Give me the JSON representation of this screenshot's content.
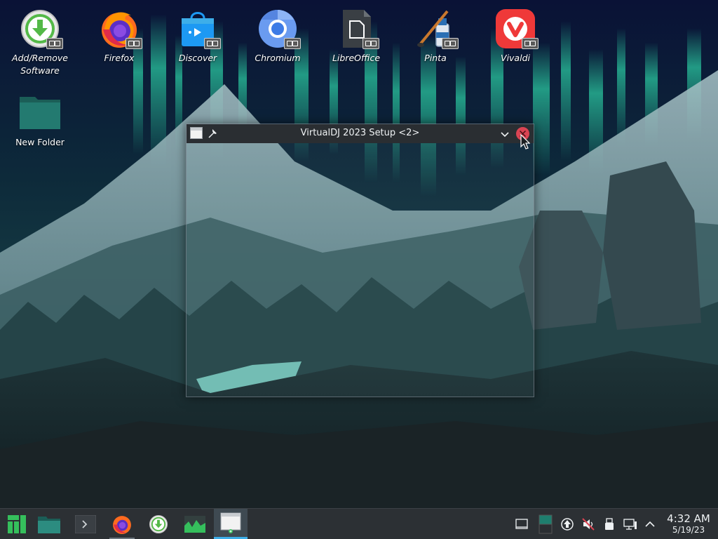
{
  "desktop": {
    "icons": [
      {
        "name": "add-remove-software",
        "label": "Add/Remove\nSoftware"
      },
      {
        "name": "firefox",
        "label": "Firefox"
      },
      {
        "name": "discover",
        "label": "Discover"
      },
      {
        "name": "chromium",
        "label": "Chromium"
      },
      {
        "name": "libreoffice",
        "label": "LibreOffice"
      },
      {
        "name": "pinta",
        "label": "Pinta"
      },
      {
        "name": "vivaldi",
        "label": "Vivaldi"
      },
      {
        "name": "new-folder",
        "label": "New Folder"
      }
    ]
  },
  "window": {
    "title": "VirtualDJ 2023 Setup <2>"
  },
  "taskbar": {
    "clock": {
      "time": "4:32 AM",
      "date": "5/19/23"
    }
  },
  "colors": {
    "taskbar_bg": "#2c3034",
    "titlebar_bg": "#2a2e32",
    "close_red": "#da4453",
    "accent": "#3daee9",
    "manjaro_green": "#35bf5c"
  }
}
